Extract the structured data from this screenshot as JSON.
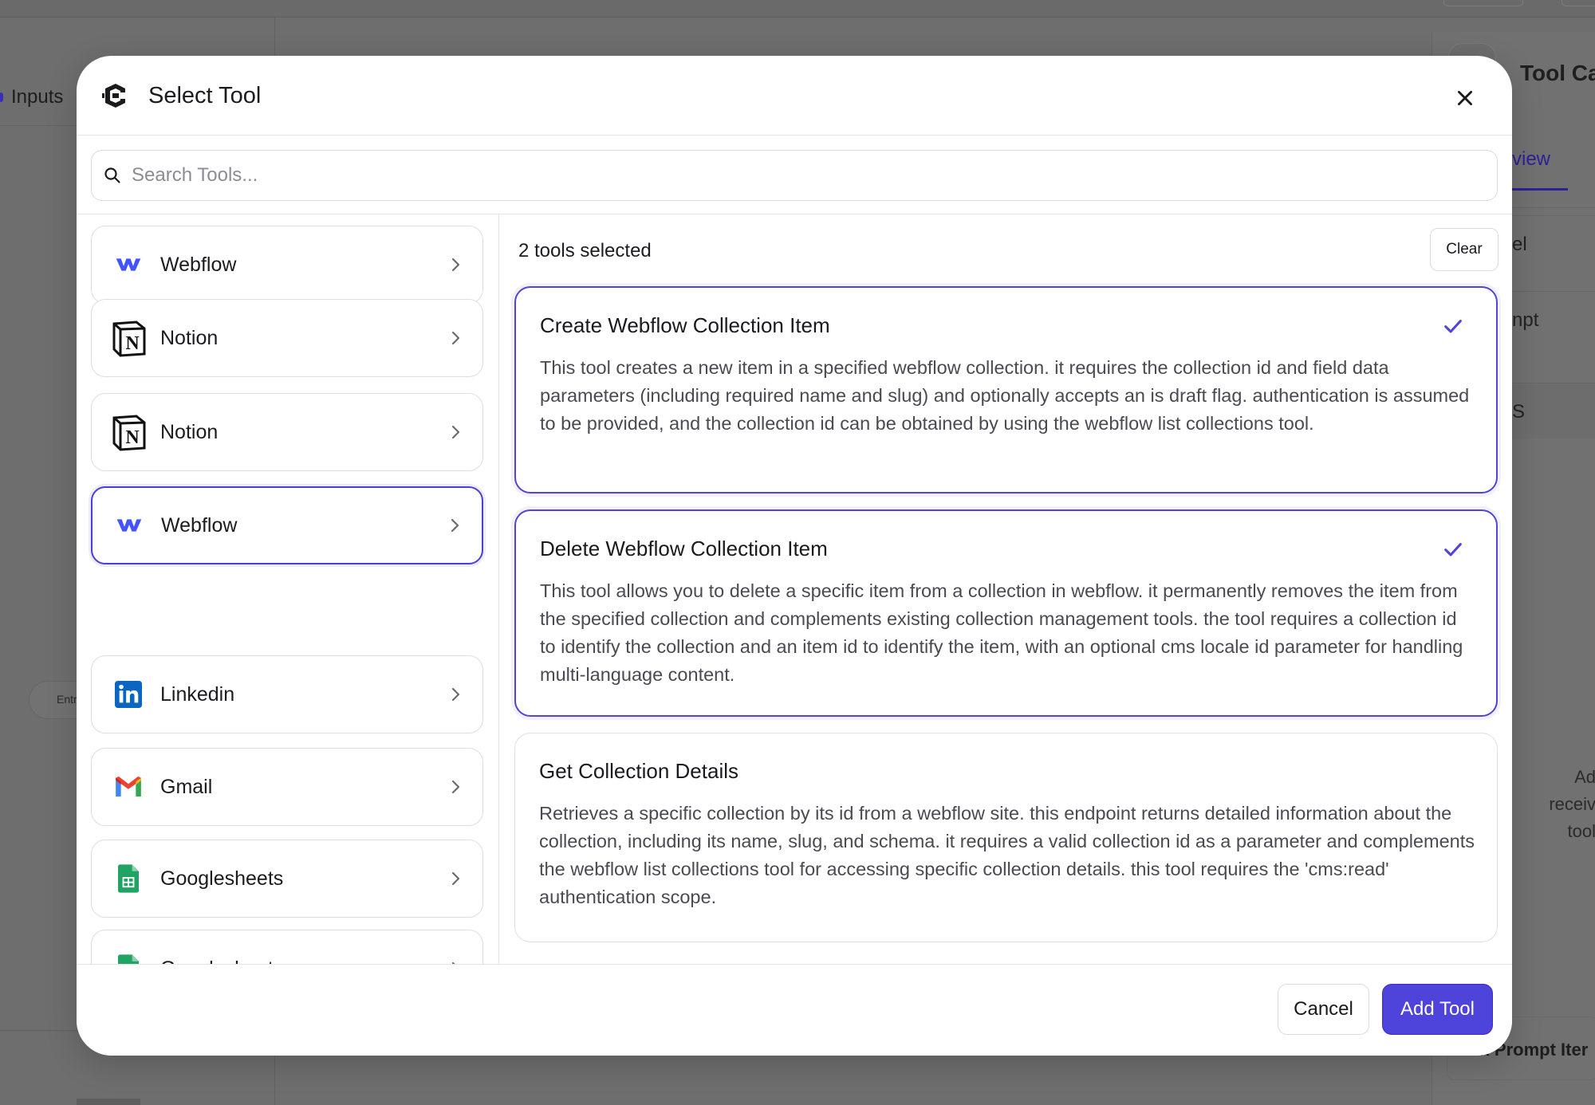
{
  "background": {
    "inputs_label": "Inputs",
    "entry_label": "Entr",
    "right_panel": {
      "title": "Tool Ca",
      "tab": "view",
      "row1": "el",
      "row2": "npt",
      "row3": "S",
      "placeholder_lines": [
        "Ad",
        "receiv",
        "tool"
      ],
      "footer": "Max Prompt Iter"
    }
  },
  "modal": {
    "title": "Select Tool",
    "logo_icon": "composio-logo-icon",
    "close_icon": "close-icon",
    "search": {
      "placeholder": "Search Tools...",
      "value": ""
    },
    "toolkits": [
      {
        "label": "Webflow",
        "icon": "webflow-icon",
        "active": false
      },
      {
        "label": "Notion",
        "icon": "notion-icon",
        "active": false
      },
      {
        "label": "Notion",
        "icon": "notion-icon",
        "active": false
      },
      {
        "label": "Webflow",
        "icon": "webflow-icon",
        "active": true
      },
      {
        "label": "Linkedin",
        "icon": "linkedin-icon",
        "active": false
      },
      {
        "label": "Gmail",
        "icon": "gmail-icon",
        "active": false
      },
      {
        "label": "Googlesheets",
        "icon": "googlesheets-icon",
        "active": false
      },
      {
        "label": "Googlesheets",
        "icon": "googlesheets-icon",
        "active": false
      }
    ],
    "selected_count": "2 tools selected",
    "clear_label": "Clear",
    "tools": [
      {
        "name": "Create Webflow Collection Item",
        "description": "This tool creates a new item in a specified webflow collection. it requires the collection id and field data parameters (including required name and slug) and optionally accepts an is draft flag. authentication is assumed to be provided, and the collection id can be obtained by using the webflow list collections tool.",
        "selected": true
      },
      {
        "name": "Delete Webflow Collection Item",
        "description": "This tool allows you to delete a specific item from a collection in webflow. it permanently removes the item from the specified collection and complements existing collection management tools. the tool requires a collection id to identify the collection and an item id to identify the item, with an optional cms locale id parameter for handling multi-language content.",
        "selected": true
      },
      {
        "name": "Get Collection Details",
        "description": "Retrieves a specific collection by its id from a webflow site. this endpoint returns detailed information about the collection, including its name, slug, and schema. it requires a valid collection id as a parameter and complements the webflow list collections tool for accessing specific collection details. this tool requires the 'cms:read' authentication scope.",
        "selected": false
      }
    ],
    "footer": {
      "cancel_label": "Cancel",
      "add_label": "Add Tool"
    }
  },
  "colors": {
    "accent": "#4e43db",
    "accent_border": "#5045d8",
    "overlay": "#6e6e6e",
    "webflow": "#4353ff",
    "linkedin": "#0a66c2",
    "sheets": "#1fa463"
  }
}
